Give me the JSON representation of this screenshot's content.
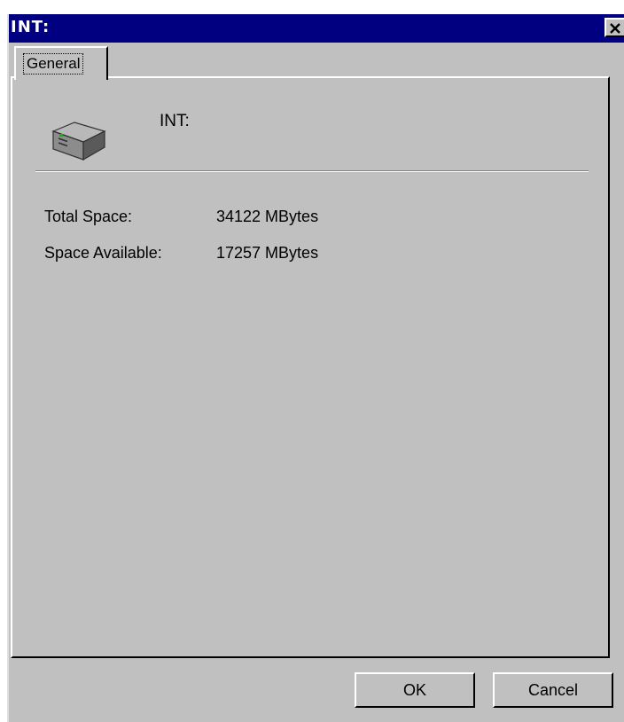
{
  "window": {
    "title": "INT:"
  },
  "tabs": [
    {
      "label": "General",
      "selected": true
    }
  ],
  "drive": {
    "name": "INT:",
    "icon": "hard-drive-icon"
  },
  "properties": [
    {
      "label": "Total Space:",
      "value": "34122 MBytes"
    },
    {
      "label": "Space Available:",
      "value": "17257 MBytes"
    }
  ],
  "buttons": {
    "ok_label": "OK",
    "cancel_label": "Cancel"
  },
  "colors": {
    "titlebar": "#000080",
    "face": "#c0c0c0"
  }
}
